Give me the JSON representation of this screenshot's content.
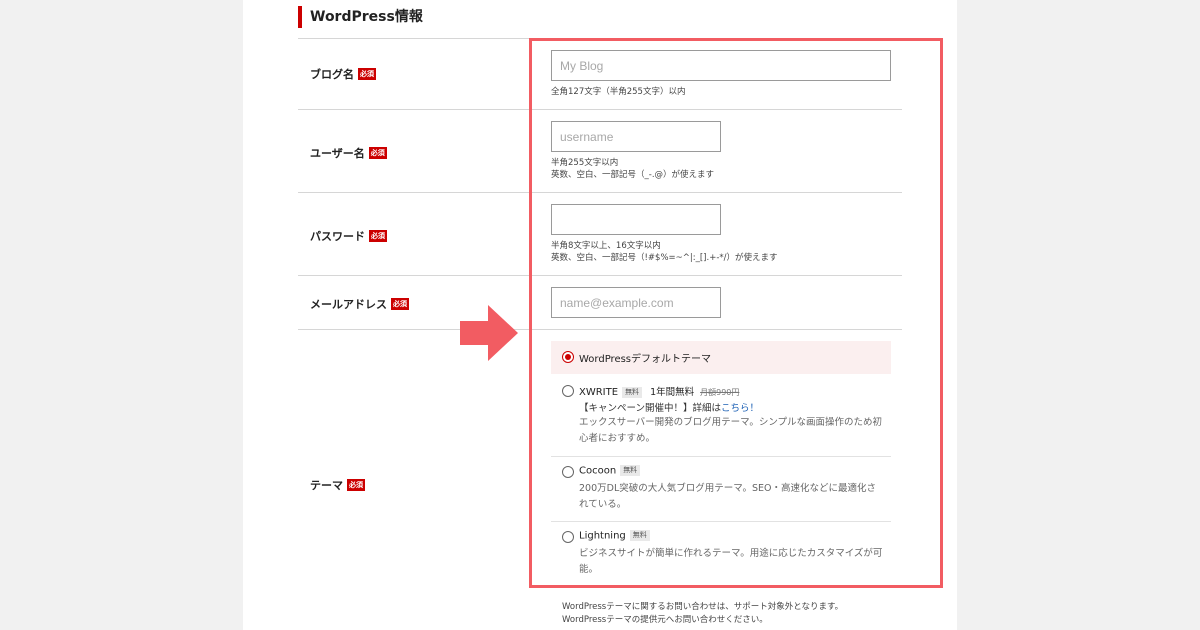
{
  "section": {
    "title": "WordPress情報"
  },
  "required_badge": "必須",
  "fields": {
    "blog_name": {
      "label": "ブログ名",
      "placeholder": "My Blog",
      "help": "全角127文字（半角255文字）以内"
    },
    "username": {
      "label": "ユーザー名",
      "placeholder": "username",
      "help_line1": "半角255文字以内",
      "help_line2": "英数、空白、一部記号（_-.@）が使えます"
    },
    "password": {
      "label": "パスワード",
      "placeholder": "",
      "help_line1": "半角8文字以上、16文字以内",
      "help_line2": "英数、空白、一部記号（!#$%=~^|:_[].+-*/）が使えます"
    },
    "email": {
      "label": "メールアドレス",
      "placeholder": "name@example.com"
    }
  },
  "theme": {
    "label": "テーマ",
    "free_badge": "無料",
    "options": [
      {
        "title": "WordPressデフォルトテーマ",
        "selected": true
      },
      {
        "title": "XWRITE",
        "promo": "1年間無料",
        "original_price": "月額990円",
        "campaign_prefix": "【キャンペーン開催中！】詳細は",
        "campaign_link": "こちら！",
        "desc": "エックスサーバー開発のブログ用テーマ。シンプルな画面操作のため初心者におすすめ。",
        "selected": false
      },
      {
        "title": "Cocoon",
        "desc": "200万DL突破の大人気ブログ用テーマ。SEO・高速化などに最適化されている。",
        "selected": false
      },
      {
        "title": "Lightning",
        "desc": "ビジネスサイトが簡単に作れるテーマ。用途に応じたカスタマイズが可能。",
        "selected": false
      }
    ]
  },
  "footer": {
    "line1": "WordPressテーマに関するお問い合わせは、サポート対象外となります。",
    "line2": "WordPressテーマの提供元へお問い合わせください。"
  },
  "colors": {
    "accent": "#cc0000",
    "highlight": "#f25c62",
    "link": "#1a5fb4"
  }
}
